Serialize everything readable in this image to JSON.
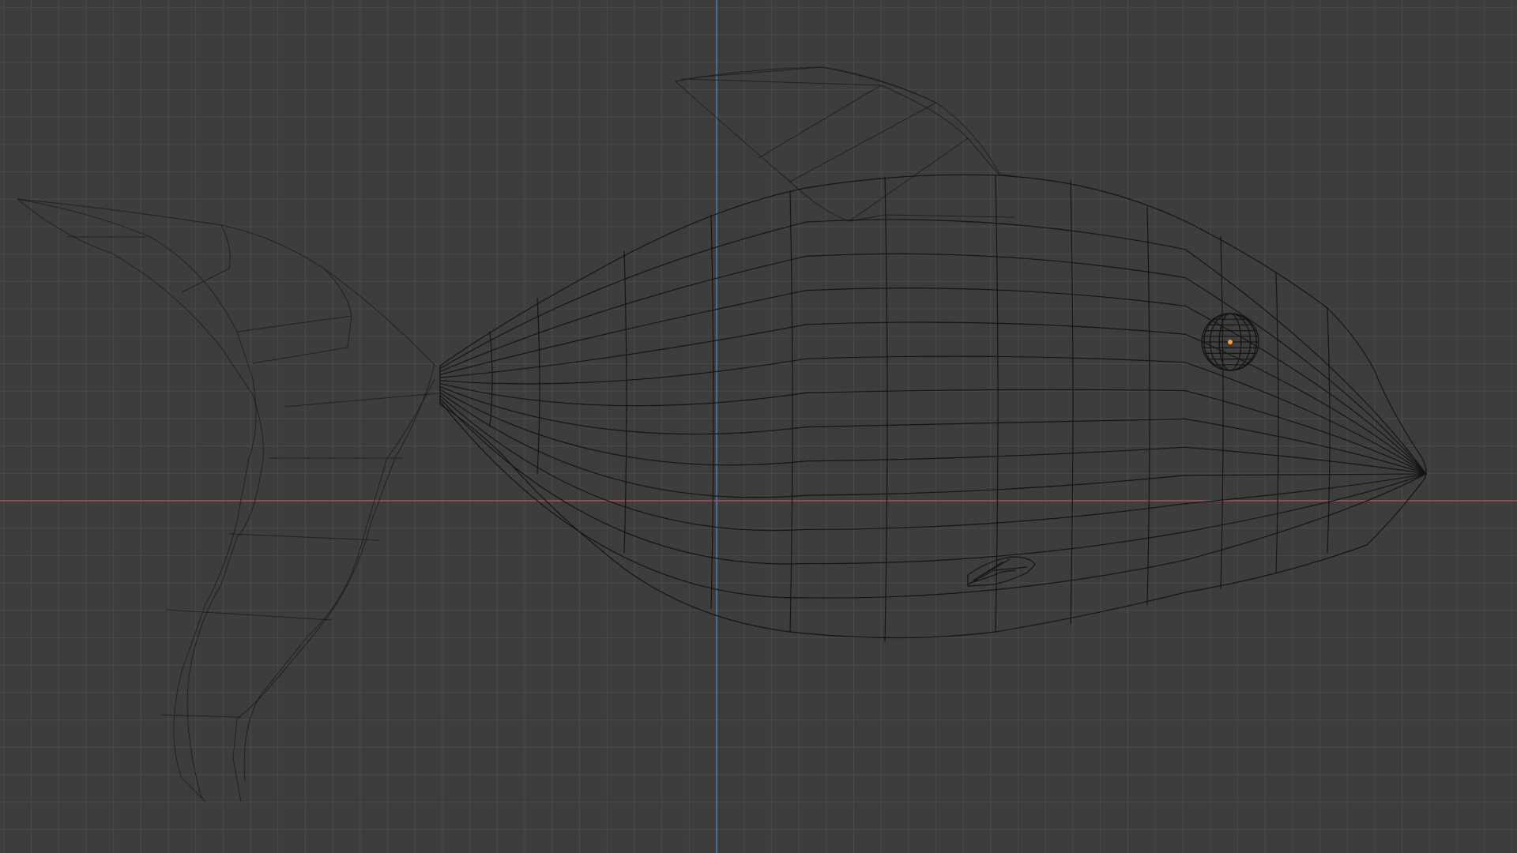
{
  "viewport": {
    "background": "#3d3d3d",
    "grid_color": "#4a4a4a",
    "x_axis_color": "#b05050",
    "y_axis_color": "#4f7fb0",
    "wireframe_color": "#151515",
    "origin_color": "#ffa030",
    "display_mode": "wireframe",
    "objects": [
      {
        "name": "body",
        "icon": "mesh-icon"
      },
      {
        "name": "tail-fin",
        "icon": "mesh-icon"
      },
      {
        "name": "dorsal-fin",
        "icon": "mesh-icon"
      },
      {
        "name": "pectoral-fin",
        "icon": "mesh-icon"
      },
      {
        "name": "eye",
        "icon": "sphere-icon"
      }
    ]
  }
}
